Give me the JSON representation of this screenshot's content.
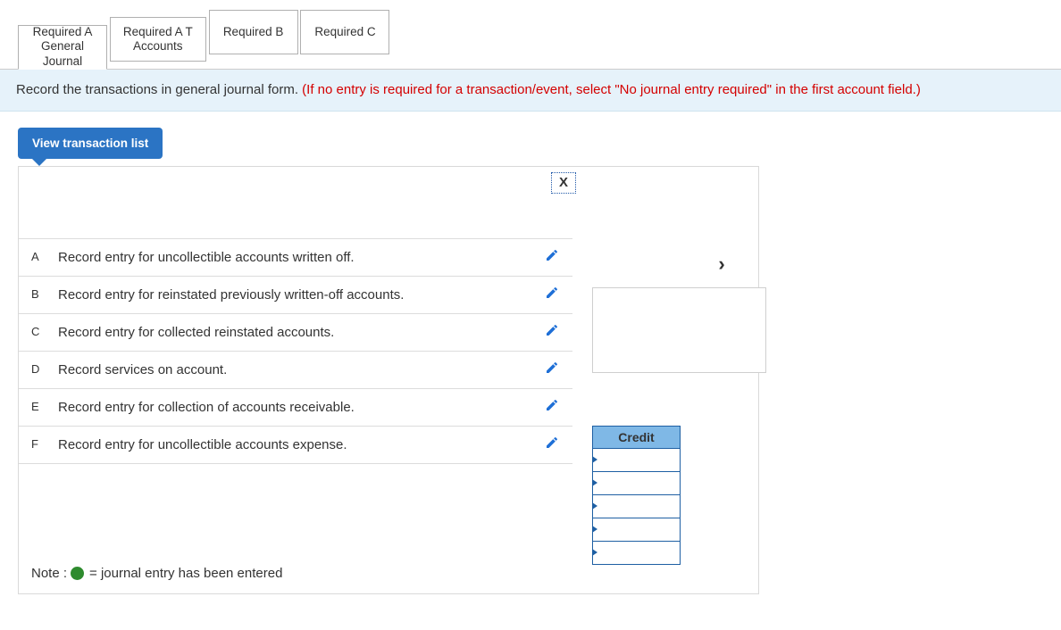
{
  "tabs": {
    "a_gj": "Required A\nGeneral\nJournal",
    "a_ta": "Required A T\nAccounts",
    "b": "Required B",
    "c": "Required C"
  },
  "instruction": {
    "black": "Record the transactions in general journal form. ",
    "red": "(If no entry is required for a transaction/event, select \"No journal entry required\" in the first account field.)"
  },
  "view_btn": "View transaction list",
  "close_label": "X",
  "next_label": "›",
  "transactions": [
    {
      "key": "A",
      "text": "Record entry for uncollectible accounts written off."
    },
    {
      "key": "B",
      "text": "Record entry for reinstated previously written-off accounts."
    },
    {
      "key": "C",
      "text": "Record entry for collected reinstated accounts."
    },
    {
      "key": "D",
      "text": "Record services on account."
    },
    {
      "key": "E",
      "text": "Record entry for collection of accounts receivable."
    },
    {
      "key": "F",
      "text": "Record entry for uncollectible accounts expense."
    }
  ],
  "credit_header": "Credit",
  "credit_rows": 5,
  "note": {
    "prefix": "Note :",
    "meaning": "= journal entry has been entered"
  }
}
